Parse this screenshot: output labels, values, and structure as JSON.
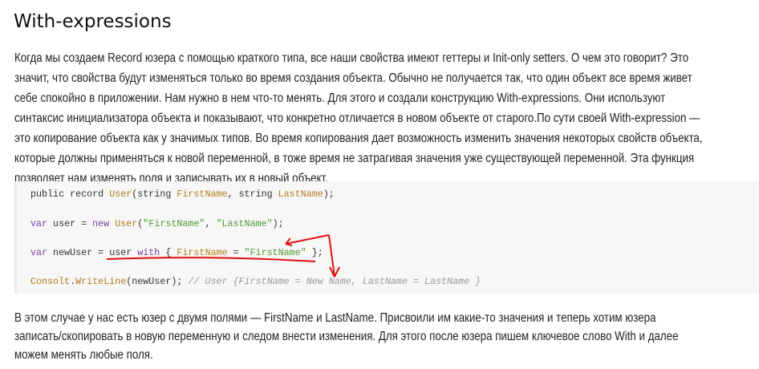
{
  "title": "With-expressions",
  "paragraph1": [
    "Когда мы создаем Record юзера с помощью краткого типа, все наши свойства имеют геттеры и Init-only setters. О чем это говорит? Это",
    "значит, что свойства будут изменяться только во время создания объекта. Обычно не получается так, что один объект все время живет",
    "себе спокойно в приложении. Нам нужно в нем что-то менять. Для этого и создали конструкцию With-expressions. Они используют",
    "синтаксис инициализатора объекта и показывают, что конкретно отличается в новом объекте от старого.По сути своей With-expression —",
    "это копирование объекта как у значимых типов. Во время копирования дает возможность изменить значения некоторых свойств объекта,",
    "которые должны применяться к новой переменной, в тоже время не затрагивая значения уже существующей переменной. Эта функция",
    "позволяет нам изменять поля и записывать их в новый объект."
  ],
  "code": {
    "l1": [
      "public record ",
      "User",
      "(string ",
      "FirstName",
      ", string ",
      "LastName",
      ");"
    ],
    "l2": [
      "var",
      " user = ",
      "new",
      " ",
      "User",
      "(",
      "\"FirstName\"",
      ", ",
      "\"LastName\"",
      ");"
    ],
    "l3": [
      "var",
      " newUser = user ",
      "with",
      " { ",
      "FirstName",
      " = ",
      "\"FirstName\"",
      " };"
    ],
    "l4": [
      "Consolt",
      ".",
      "WriteLine",
      "(newUser); ",
      "// User {FirstName = New Name, LastName = LastName }"
    ]
  },
  "paragraph2": [
    "В этом случае у нас есть юзер с двумя полями — FirstName и LastName. Присвоили им какие-то значения и теперь хотим юзера",
    "записать/скопировать в новую переменную и следом внести изменения. Для этого после юзера пишем ключевое слово With и далее",
    "можем менять любые поля."
  ],
  "colors": {
    "annotation": "#e01010",
    "keyword": "#7a3e9d",
    "type": "#b07d1b",
    "string": "#4e9a2f",
    "comment": "#999999"
  }
}
